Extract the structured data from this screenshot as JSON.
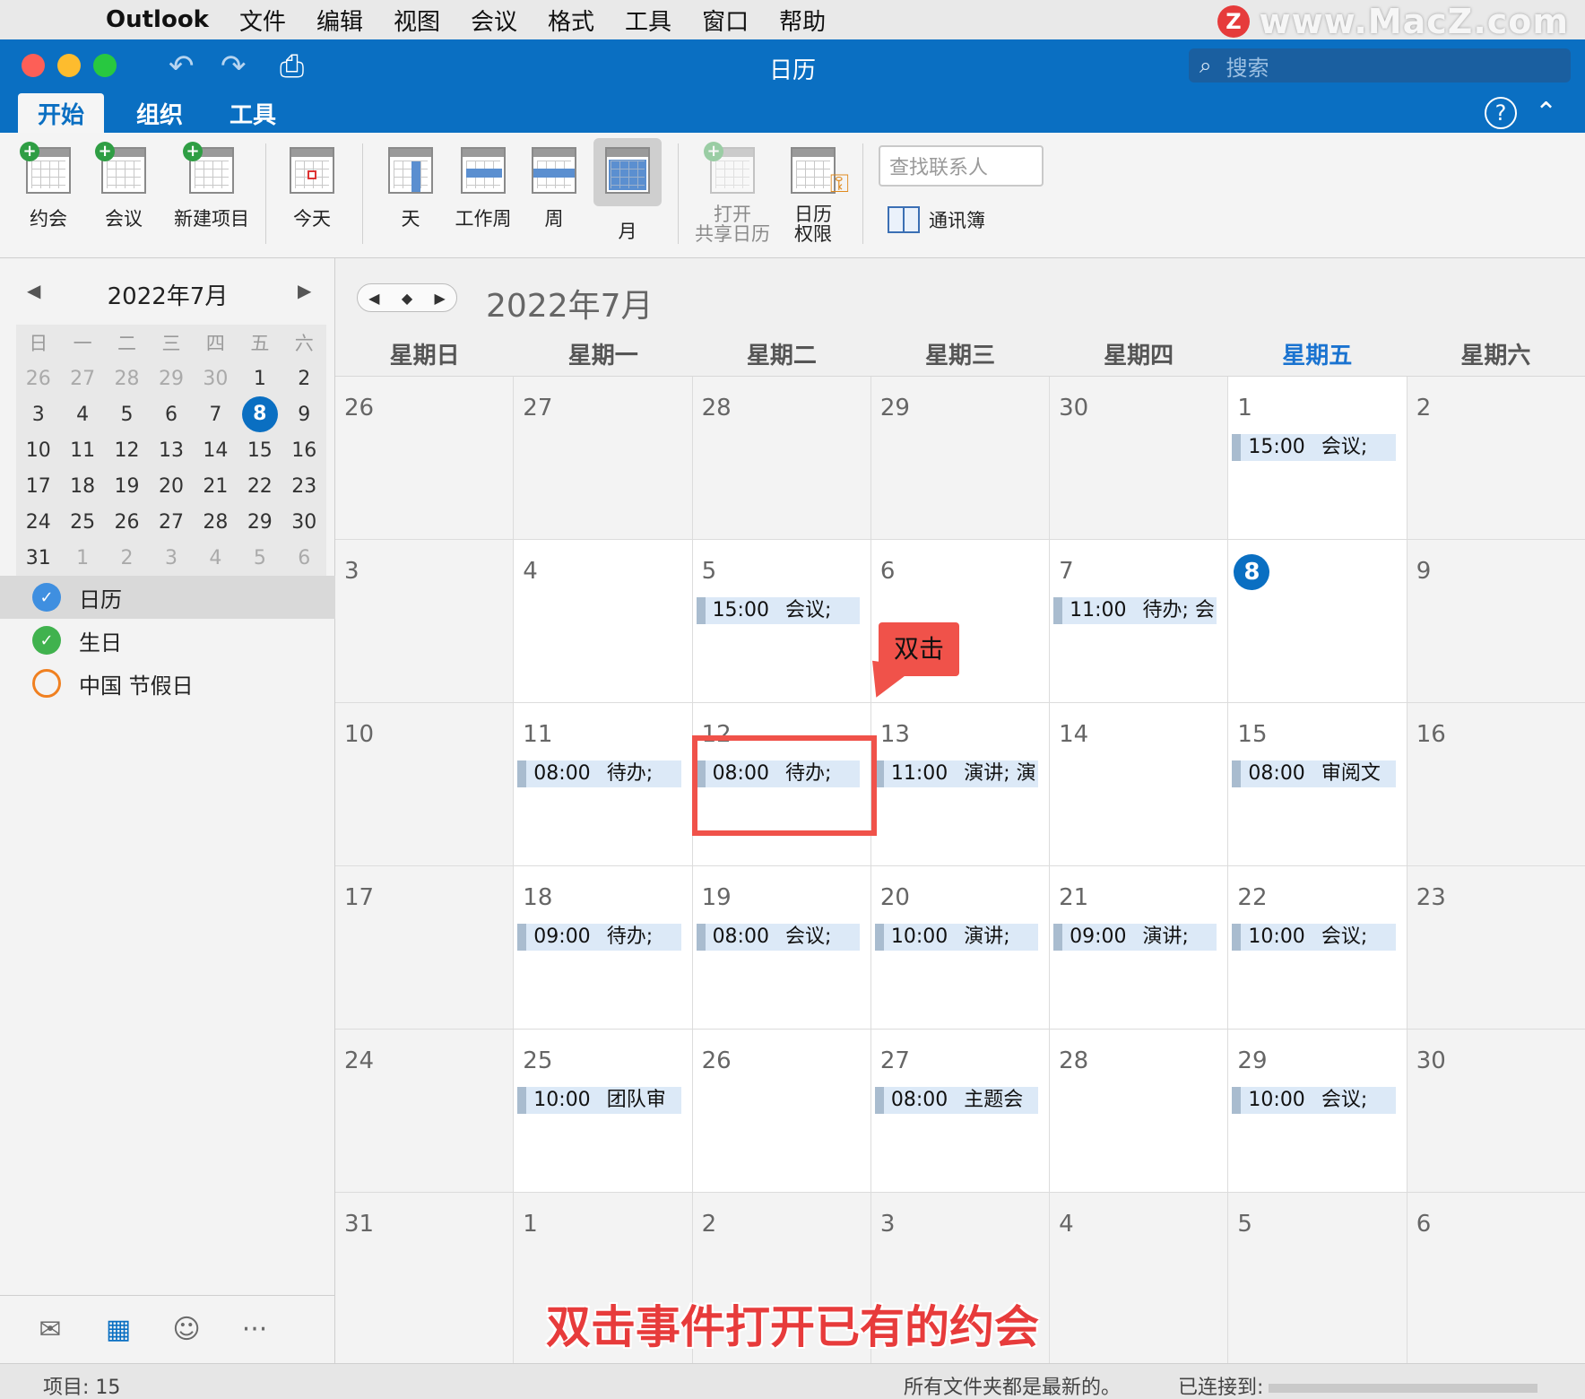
{
  "menubar": {
    "app": "Outlook",
    "items": [
      "文件",
      "编辑",
      "视图",
      "会议",
      "格式",
      "工具",
      "窗口",
      "帮助"
    ],
    "watermark": "www.MacZ.com"
  },
  "window": {
    "title": "日历",
    "search_placeholder": "搜索"
  },
  "tabs": [
    "开始",
    "组织",
    "工具"
  ],
  "ribbon": {
    "appointment": "约会",
    "meeting": "会议",
    "new_item": "新建项目",
    "today": "今天",
    "day": "天",
    "work_week": "工作周",
    "week": "周",
    "month": "月",
    "open_shared_1": "打开",
    "open_shared_2": "共享日历",
    "cal_perm_1": "日历",
    "cal_perm_2": "权限",
    "find_contact": "查找联系人",
    "address_book": "通讯簿"
  },
  "mini_calendar": {
    "title": "2022年7月",
    "dow": [
      "日",
      "一",
      "二",
      "三",
      "四",
      "五",
      "六"
    ],
    "weeks": [
      [
        "26",
        "27",
        "28",
        "29",
        "30",
        "1",
        "2"
      ],
      [
        "3",
        "4",
        "5",
        "6",
        "7",
        "8",
        "9"
      ],
      [
        "10",
        "11",
        "12",
        "13",
        "14",
        "15",
        "16"
      ],
      [
        "17",
        "18",
        "19",
        "20",
        "21",
        "22",
        "23"
      ],
      [
        "24",
        "25",
        "26",
        "27",
        "28",
        "29",
        "30"
      ],
      [
        "31",
        "1",
        "2",
        "3",
        "4",
        "5",
        "6"
      ]
    ]
  },
  "calendars": [
    {
      "label": "日历"
    },
    {
      "label": "生日"
    },
    {
      "label": "中国 节假日"
    }
  ],
  "main": {
    "month_title": "2022年7月",
    "dow": [
      "星期日",
      "星期一",
      "星期二",
      "星期三",
      "星期四",
      "星期五",
      "星期六"
    ],
    "weeks": [
      [
        {
          "d": "26"
        },
        {
          "d": "27"
        },
        {
          "d": "28"
        },
        {
          "d": "29"
        },
        {
          "d": "30"
        },
        {
          "d": "1",
          "ev": {
            "time": "15:00",
            "title": "会议;"
          }
        },
        {
          "d": "2"
        }
      ],
      [
        {
          "d": "3"
        },
        {
          "d": "4"
        },
        {
          "d": "5",
          "ev": {
            "time": "15:00",
            "title": "会议;"
          }
        },
        {
          "d": "6"
        },
        {
          "d": "7",
          "ev": {
            "time": "11:00",
            "title": "待办; 会"
          }
        },
        {
          "d": "8",
          "today": true
        },
        {
          "d": "9"
        }
      ],
      [
        {
          "d": "10"
        },
        {
          "d": "11",
          "ev": {
            "time": "08:00",
            "title": "待办;"
          }
        },
        {
          "d": "12",
          "ev": {
            "time": "08:00",
            "title": "待办;"
          }
        },
        {
          "d": "13",
          "ev": {
            "time": "11:00",
            "title": "演讲; 演"
          }
        },
        {
          "d": "14"
        },
        {
          "d": "15",
          "ev": {
            "time": "08:00",
            "title": "审阅文"
          }
        },
        {
          "d": "16"
        }
      ],
      [
        {
          "d": "17"
        },
        {
          "d": "18",
          "ev": {
            "time": "09:00",
            "title": "待办;"
          }
        },
        {
          "d": "19",
          "ev": {
            "time": "08:00",
            "title": "会议;"
          }
        },
        {
          "d": "20",
          "ev": {
            "time": "10:00",
            "title": "演讲;"
          }
        },
        {
          "d": "21",
          "ev": {
            "time": "09:00",
            "title": "演讲;"
          }
        },
        {
          "d": "22",
          "ev": {
            "time": "10:00",
            "title": "会议;"
          }
        },
        {
          "d": "23"
        }
      ],
      [
        {
          "d": "24"
        },
        {
          "d": "25",
          "ev": {
            "time": "10:00",
            "title": "团队审"
          }
        },
        {
          "d": "26"
        },
        {
          "d": "27",
          "ev": {
            "time": "08:00",
            "title": "主题会"
          }
        },
        {
          "d": "28"
        },
        {
          "d": "29",
          "ev": {
            "time": "10:00",
            "title": "会议;"
          }
        },
        {
          "d": "30"
        }
      ],
      [
        {
          "d": "31"
        },
        {
          "d": "1"
        },
        {
          "d": "2"
        },
        {
          "d": "3"
        },
        {
          "d": "4"
        },
        {
          "d": "5"
        },
        {
          "d": "6"
        }
      ]
    ]
  },
  "annotation": {
    "callout": "双击",
    "caption": "双击事件打开已有的约会"
  },
  "status": {
    "items": "项目: 15",
    "uptodate": "所有文件夹都是最新的。",
    "connected": "已连接到:"
  },
  "colors": {
    "accent": "#0a6fc2",
    "event_bg": "#dce9f7",
    "annotation": "#f0524a"
  }
}
